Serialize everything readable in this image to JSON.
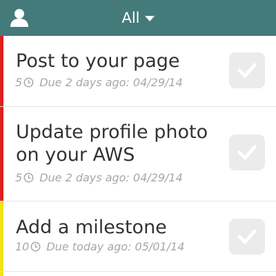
{
  "header": {
    "filter_label": "All",
    "background": "#457a7b"
  },
  "tasks": [
    {
      "title": "Post to your page",
      "points": "5",
      "due": "Due 2 days ago: 04/29/14",
      "priority_color": "#dd2020"
    },
    {
      "title": "Update profile photo on your AWS",
      "points": "5",
      "due": "Due 2 days ago: 04/29/14",
      "priority_color": "#dd2020"
    },
    {
      "title": "Add a milestone",
      "points": "10",
      "due": "Due today ago: 05/01/14",
      "priority_color": "#f0e21a"
    },
    {
      "priority_color": "#f0e21a"
    }
  ],
  "icons": {
    "user": "user-icon",
    "filter_dropdown": "chevron-down-icon",
    "clock": "clock-icon",
    "checkbox": "checkmark-icon"
  }
}
